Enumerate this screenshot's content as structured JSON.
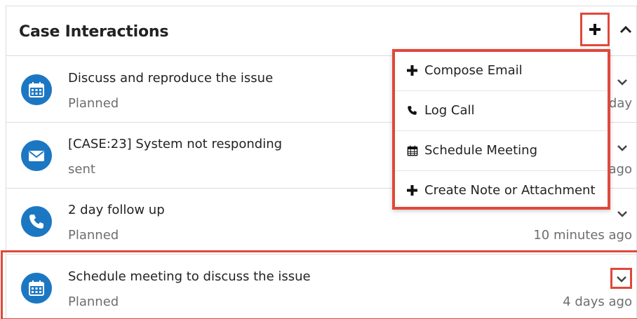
{
  "panel": {
    "title": "Case Interactions"
  },
  "interactions": [
    {
      "icon": "calendar-icon",
      "subject": "Discuss and reproduce the issue",
      "status": "Planned",
      "time": "day"
    },
    {
      "icon": "envelope-icon",
      "subject": "[CASE:23] System not responding",
      "status": "sent",
      "time": "ago"
    },
    {
      "icon": "phone-icon",
      "subject": "2 day follow up",
      "status": "Planned",
      "time": "10 minutes ago"
    },
    {
      "icon": "calendar-icon",
      "subject": "Schedule meeting to discuss the issue",
      "status": "Planned",
      "time": "4 days ago"
    }
  ],
  "add_menu": {
    "items": [
      {
        "icon": "plus-icon",
        "label": "Compose Email"
      },
      {
        "icon": "phone-icon",
        "label": "Log Call"
      },
      {
        "icon": "calendar-icon",
        "label": "Schedule Meeting"
      },
      {
        "icon": "plus-icon",
        "label": "Create Note or Attachment"
      }
    ]
  },
  "colors": {
    "accent_blue": "#1c77c3",
    "highlight_red": "#e0483a"
  }
}
